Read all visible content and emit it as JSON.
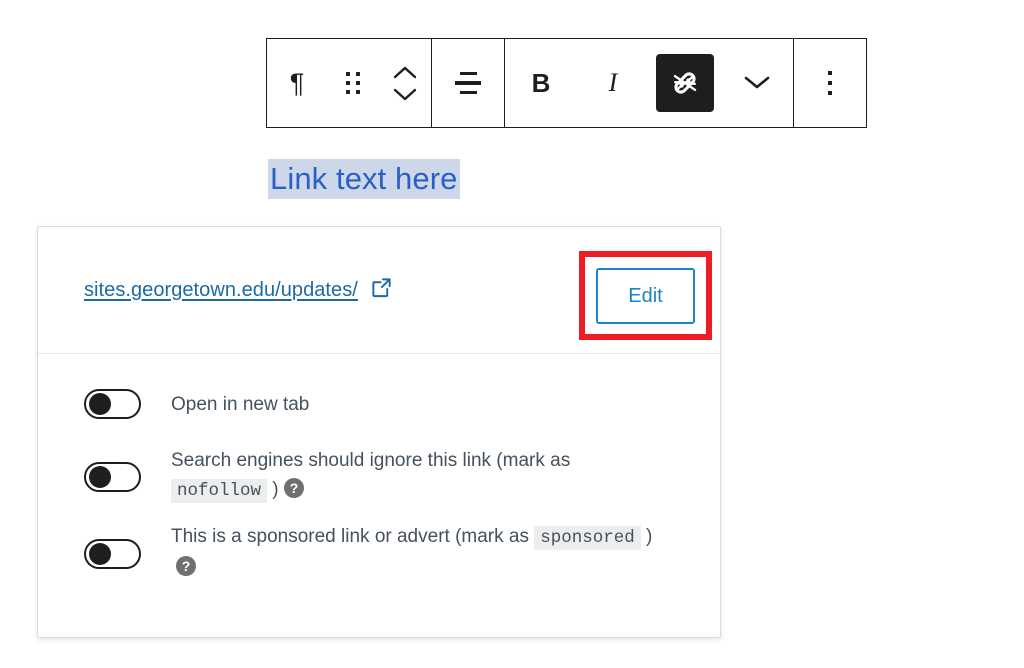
{
  "toolbar": {
    "groups": [
      {
        "name": "block-controls",
        "buttons": [
          {
            "label": "Paragraph",
            "icon": "paragraph-icon",
            "glyph": "¶",
            "active": false
          },
          {
            "label": "Drag",
            "icon": "drag-handle-icon",
            "active": false
          },
          {
            "label": "Move up or down",
            "icon": "move-up-down-icon",
            "active": false
          }
        ]
      },
      {
        "name": "alignment",
        "buttons": [
          {
            "label": "Align text",
            "icon": "align-center-icon",
            "active": false
          }
        ]
      },
      {
        "name": "formatting",
        "buttons": [
          {
            "label": "Bold",
            "icon": "bold-icon",
            "glyph": "B",
            "active": false
          },
          {
            "label": "Italic",
            "icon": "italic-icon",
            "glyph": "I",
            "active": false
          },
          {
            "label": "Link",
            "icon": "link-icon",
            "active": true
          },
          {
            "label": "More rich text controls",
            "icon": "chevron-down-icon",
            "active": false
          }
        ]
      },
      {
        "name": "options",
        "buttons": [
          {
            "label": "Options",
            "icon": "more-vertical-icon",
            "active": false
          }
        ]
      }
    ]
  },
  "editor": {
    "selected_text": "Link text here",
    "selection_color": "#cdd7ea",
    "link_color": "#2c5fc3"
  },
  "link_popover": {
    "url": "sites.georgetown.edu/updates/",
    "url_color": "#1a6aa8",
    "external_link_icon": "external-link-icon",
    "edit_label": "Edit",
    "edit_button_color": "#1a84c7",
    "highlight_color": "#ee1c25",
    "options": [
      {
        "id": "open-in-new-tab",
        "enabled": false,
        "text_before": "Open in new tab",
        "code": "",
        "text_after": "",
        "has_help": false
      },
      {
        "id": "nofollow",
        "enabled": false,
        "text_before": "Search engines should ignore this link (mark as ",
        "code": "nofollow",
        "text_after": " )",
        "has_help": true,
        "help_icon": "help-icon"
      },
      {
        "id": "sponsored",
        "enabled": false,
        "text_before": "This is a sponsored link or advert (mark as ",
        "code": "sponsored",
        "text_after": " )",
        "has_help": true,
        "help_icon": "help-icon"
      }
    ]
  }
}
